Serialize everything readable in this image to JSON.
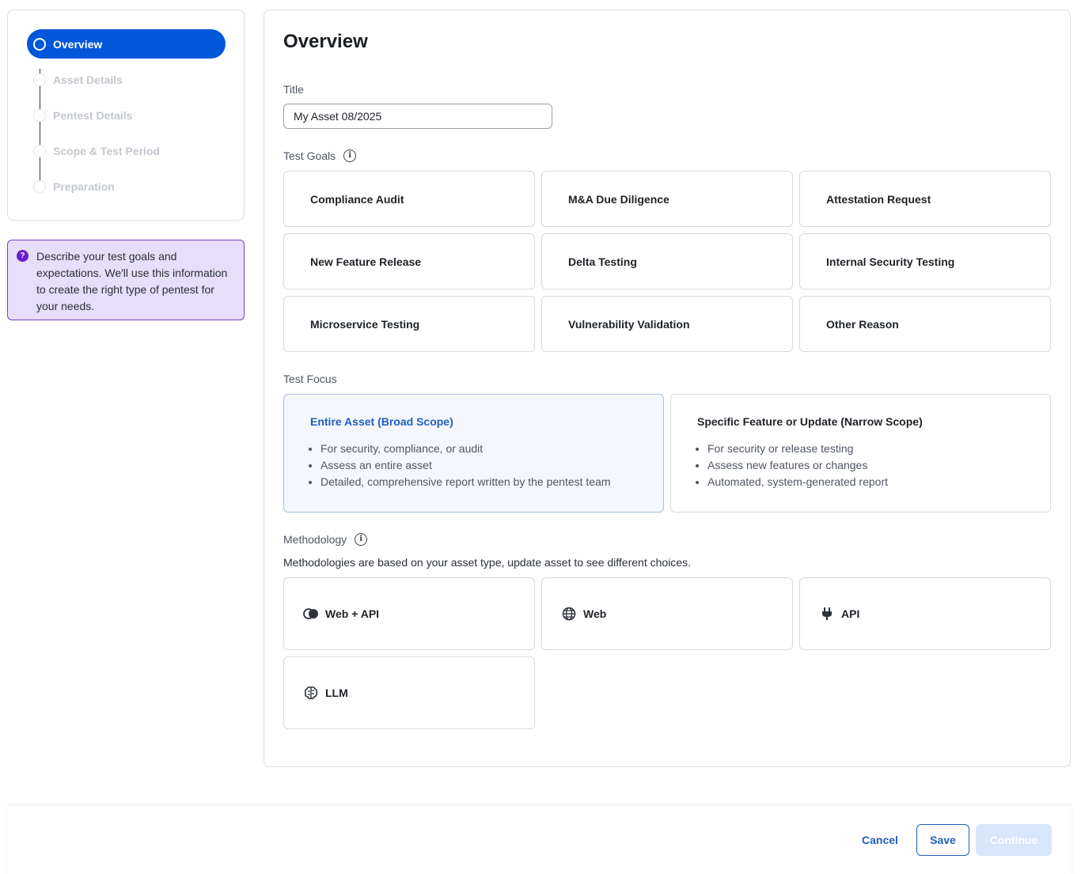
{
  "stepper": {
    "steps": [
      {
        "label": "Overview"
      },
      {
        "label": "Asset Details"
      },
      {
        "label": "Pentest Details"
      },
      {
        "label": "Scope & Test Period"
      },
      {
        "label": "Preparation"
      }
    ],
    "active_index": 0
  },
  "info_box": {
    "icon": "question-icon",
    "glyph": "?",
    "text": "Describe your test goals and expectations. We'll use this information to create the right type of pentest for your needs."
  },
  "main": {
    "heading": "Overview",
    "title_label": "Title",
    "title_value": "My Asset 08/2025",
    "test_goals_label": "Test Goals",
    "info_glyph": "i",
    "test_goals": [
      "Compliance Audit",
      "M&A Due Diligence",
      "Attestation Request",
      "New Feature Release",
      "Delta Testing",
      "Internal Security Testing",
      "Microservice Testing",
      "Vulnerability Validation",
      "Other Reason"
    ],
    "test_focus_label": "Test Focus",
    "test_focus": [
      {
        "title": "Entire Asset (Broad Scope)",
        "selected": true,
        "bullets": [
          "For security, compliance, or audit",
          "Assess an entire asset",
          "Detailed, comprehensive report written by the pentest team"
        ]
      },
      {
        "title": "Specific Feature or Update (Narrow Scope)",
        "selected": false,
        "bullets": [
          "For security or release testing",
          "Assess new features or changes",
          "Automated, system-generated report"
        ]
      }
    ],
    "methodology_label": "Methodology",
    "methodology_note": "Methodologies are based on your asset type, update asset to see different choices.",
    "methodologies": [
      {
        "label": "Web + API",
        "icon": "overlap-circles-icon"
      },
      {
        "label": "Web",
        "icon": "globe-icon"
      },
      {
        "label": "API",
        "icon": "plug-icon"
      },
      {
        "label": "LLM",
        "icon": "brain-icon"
      }
    ]
  },
  "footer": {
    "cancel": "Cancel",
    "save": "Save",
    "continue": "Continue"
  },
  "colors": {
    "primary": "#0057d9",
    "link": "#1f5fbf",
    "info_bg": "#e6defa",
    "info_border": "#7a3fc7",
    "disabled_bg": "#d7e6fb"
  }
}
